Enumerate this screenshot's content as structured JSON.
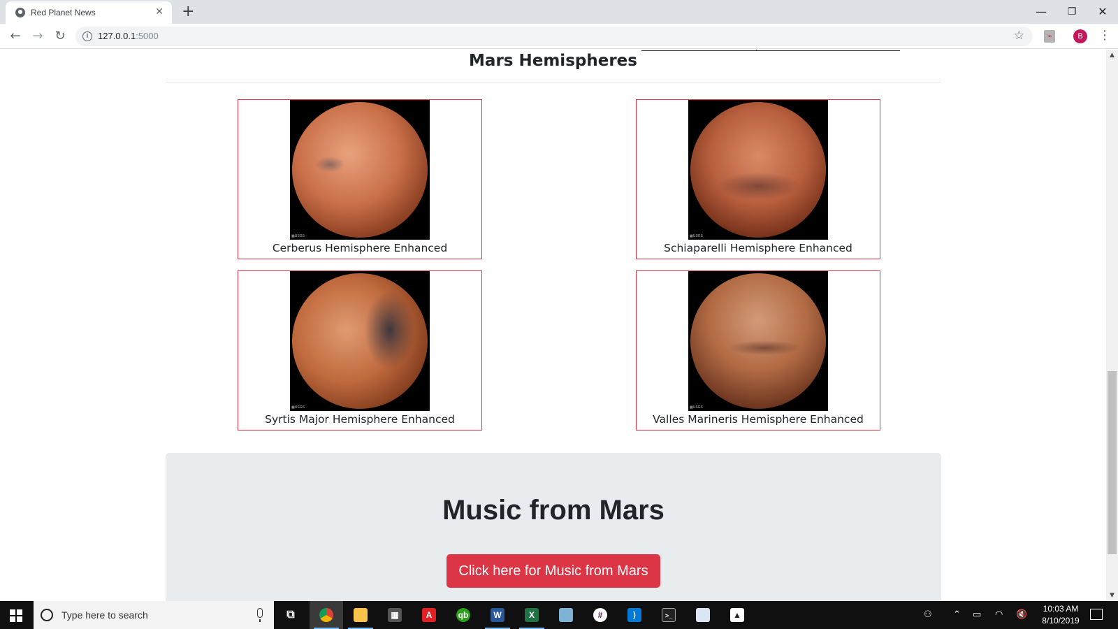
{
  "browser": {
    "tab_title": "Red Planet News",
    "tab_close": "✕",
    "new_tab": "+",
    "url_host": "127.0.0.1",
    "url_port": ":5000",
    "back": "←",
    "forward": "→",
    "reload": "↻",
    "bookmark": "☆",
    "profile_initial": "B",
    "menu": "⋮",
    "minimize": "—",
    "restore": "❐",
    "close": "✕"
  },
  "page": {
    "section_title": "Mars Hemispheres",
    "hemispheres": [
      {
        "title": "Cerberus Hemisphere Enhanced"
      },
      {
        "title": "Schiaparelli Hemisphere Enhanced"
      },
      {
        "title": "Syrtis Major Hemisphere Enhanced"
      },
      {
        "title": "Valles Marineris Hemisphere Enhanced"
      }
    ],
    "music": {
      "title": "Music from Mars",
      "button_label": "Click here for Music from Mars"
    }
  },
  "colors": {
    "accent_red": "#dc3545",
    "jumbotron_bg": "#e9ecef"
  },
  "taskbar": {
    "search_placeholder": "Type here to search",
    "time": "10:03 AM",
    "date": "8/10/2019",
    "apps": [
      "task-view-icon",
      "chrome-icon",
      "file-explorer-icon",
      "calculator-icon",
      "acrobat-icon",
      "quickbooks-icon",
      "word-icon",
      "excel-icon",
      "notepad-icon",
      "slack-icon",
      "vscode-icon",
      "terminal-icon",
      "document-icon",
      "photos-icon"
    ]
  }
}
